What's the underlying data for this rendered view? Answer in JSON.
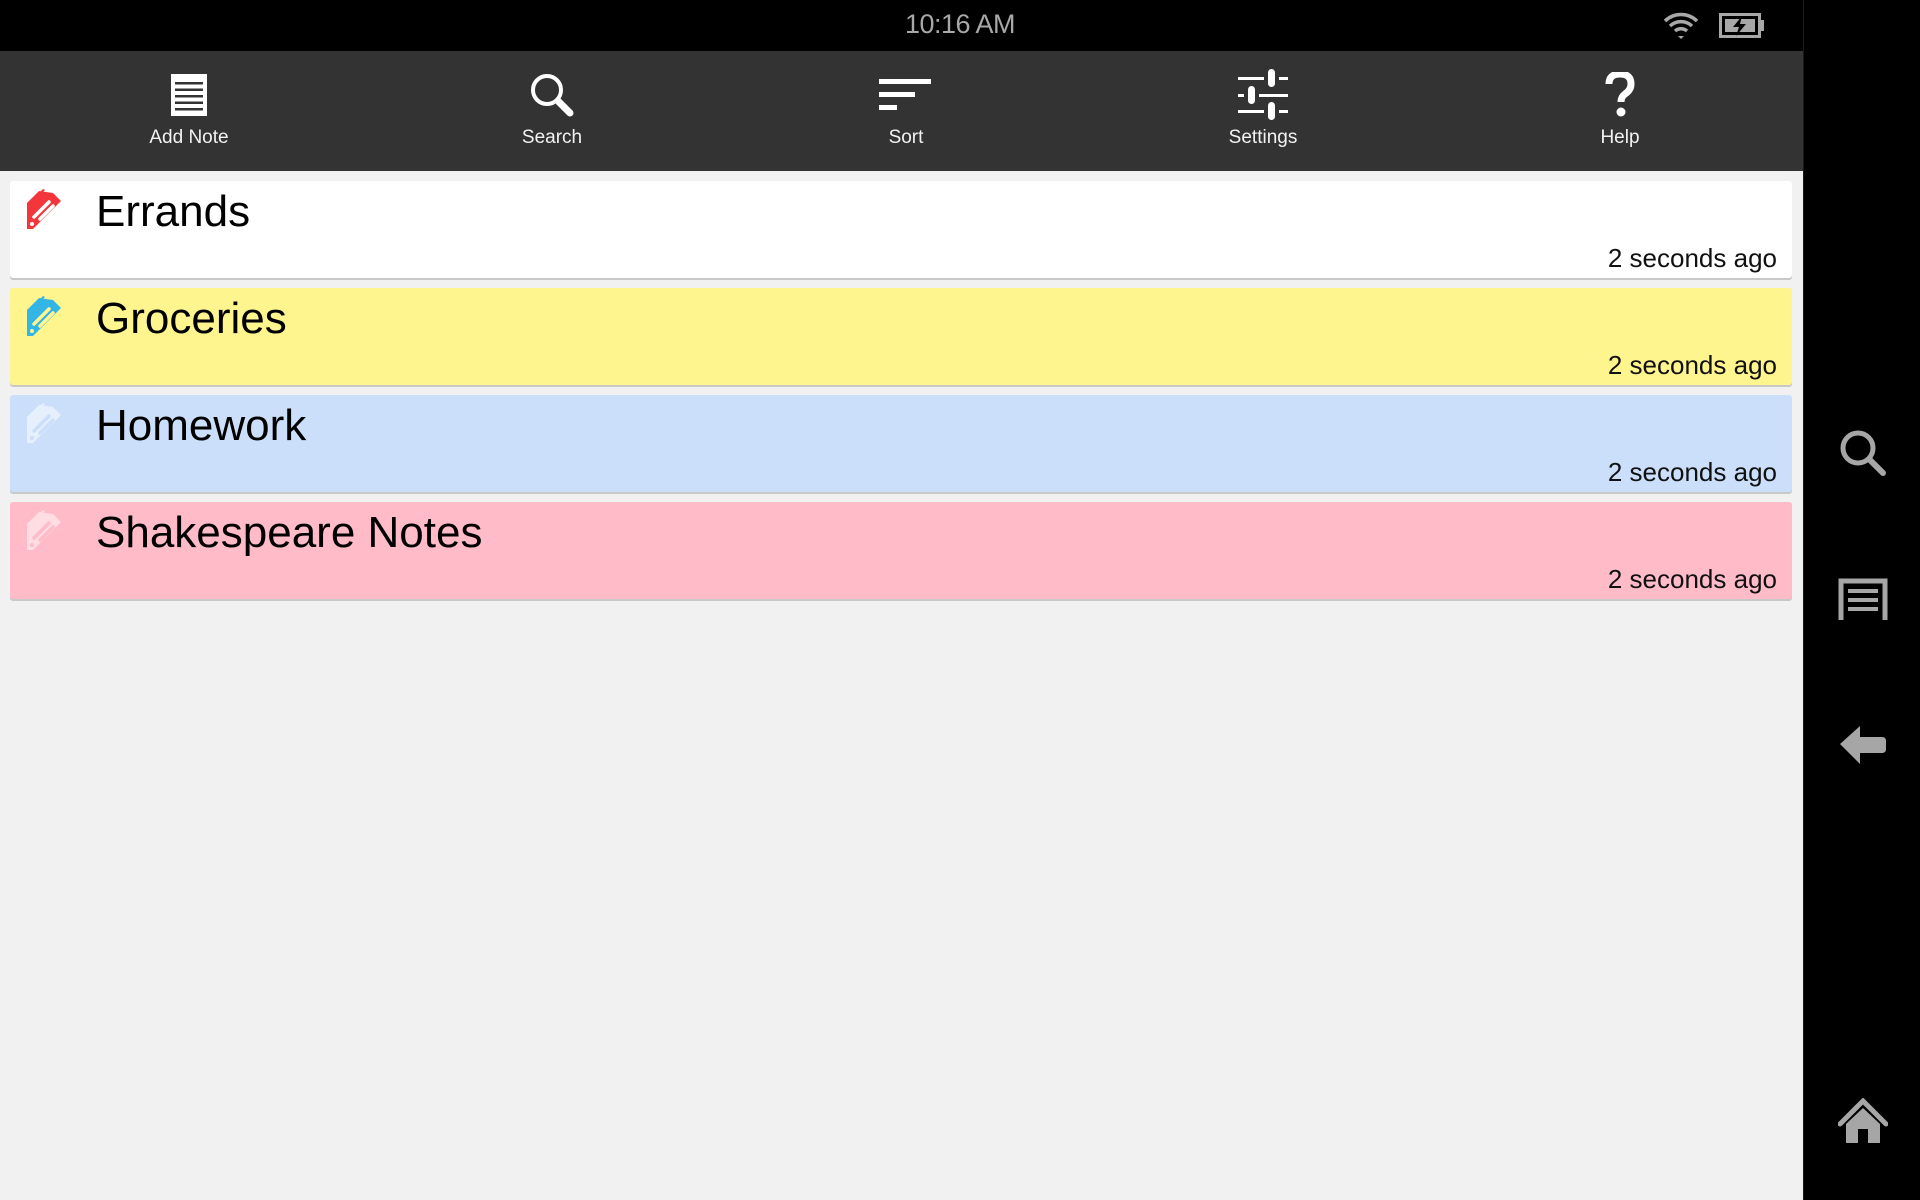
{
  "status_bar": {
    "time": "10:16 AM",
    "icons": [
      "wifi-icon",
      "battery-charging-icon"
    ]
  },
  "action_bar": {
    "items": [
      {
        "label": "Add Note",
        "icon": "add-note-icon"
      },
      {
        "label": "Search",
        "icon": "search-icon"
      },
      {
        "label": "Sort",
        "icon": "sort-icon"
      },
      {
        "label": "Settings",
        "icon": "settings-icon"
      },
      {
        "label": "Help",
        "icon": "help-icon"
      }
    ]
  },
  "notes": [
    {
      "title": "Errands",
      "time": "2 seconds ago",
      "bg": "#ffffff",
      "tag_color": "#f2363c"
    },
    {
      "title": "Groceries",
      "time": "2 seconds ago",
      "bg": "#fff58f",
      "tag_color": "#33b5e5"
    },
    {
      "title": "Homework",
      "time": "2 seconds ago",
      "bg": "#cbdffb",
      "tag_color": "#e6f0fd"
    },
    {
      "title": "Shakespeare Notes",
      "time": "2 seconds ago",
      "bg": "#ffbbc8",
      "tag_color": "#ffdde3"
    }
  ],
  "nav_bar": {
    "buttons": [
      "search-icon",
      "menu-icon",
      "back-icon",
      "home-icon"
    ],
    "icon_color": "#a6a6a6"
  }
}
